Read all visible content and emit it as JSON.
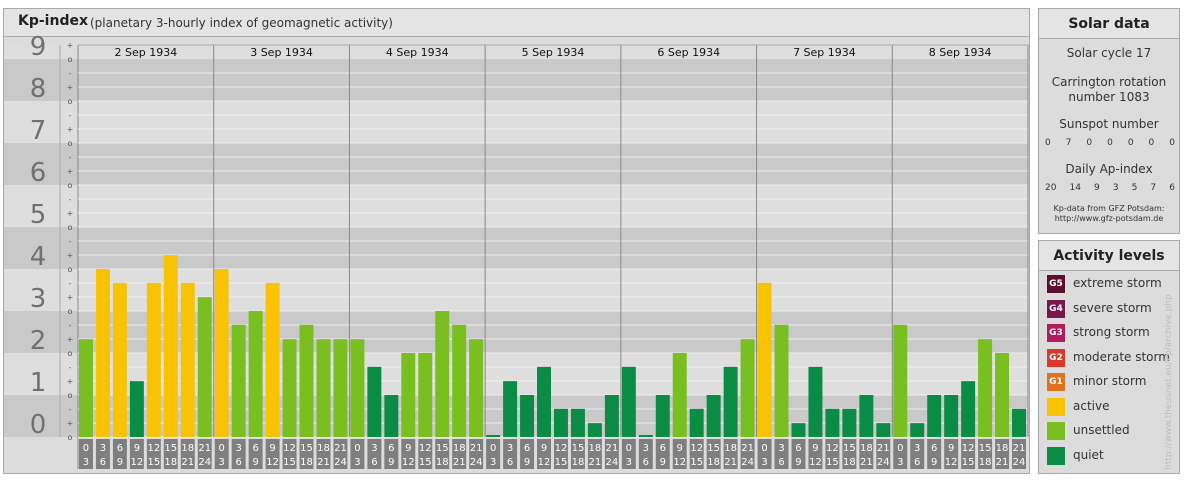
{
  "header": {
    "title": "Kp-index",
    "subtitle": "(planetary 3-hourly index of geomagnetic activity)"
  },
  "solar": {
    "heading": "Solar data",
    "cycle": "Solar cycle 17",
    "carrington_line1": "Carrington rotation",
    "carrington_line2": "number 1083",
    "sunspot_heading": "Sunspot number",
    "sunspot_values": [
      "0",
      "7",
      "0",
      "0",
      "0",
      "0",
      "0"
    ],
    "ap_heading": "Daily Ap-index",
    "ap_values": [
      "20",
      "14",
      "9",
      "3",
      "5",
      "7",
      "6"
    ],
    "source_line1": "Kp-data from GFZ Potsdam:",
    "source_line2": "http://www.gfz-potsdam.de"
  },
  "levels": {
    "heading": "Activity levels",
    "items": [
      {
        "badge": "G5",
        "label": "extreme storm",
        "color": "#5a0f2e"
      },
      {
        "badge": "G4",
        "label": "severe storm",
        "color": "#7a1649"
      },
      {
        "badge": "G3",
        "label": "strong storm",
        "color": "#b01c5c"
      },
      {
        "badge": "G2",
        "label": "moderate storm",
        "color": "#d8392b"
      },
      {
        "badge": "G1",
        "label": "minor storm",
        "color": "#e0741e"
      },
      {
        "badge": "",
        "label": "active",
        "color": "#f7c304"
      },
      {
        "badge": "",
        "label": "unsettled",
        "color": "#78bf1f"
      },
      {
        "badge": "",
        "label": "quiet",
        "color": "#0a8c45"
      }
    ]
  },
  "watermark": "http://www.theusnet.eu/kp/archive.php",
  "chart_data": {
    "type": "bar",
    "title": "Kp-index",
    "subtitle": "(planetary 3-hourly index of geomagnetic activity)",
    "ylim": [
      0,
      9
    ],
    "y_ticks": [
      "0",
      "1",
      "2",
      "3",
      "4",
      "5",
      "6",
      "7",
      "8",
      "9"
    ],
    "y_minor_marks": [
      "o",
      "+",
      "-"
    ],
    "days": [
      "2 Sep 1934",
      "3 Sep 1934",
      "4 Sep 1934",
      "5 Sep 1934",
      "6 Sep 1934",
      "7 Sep 1934",
      "8 Sep 1934"
    ],
    "slot_labels_top": [
      "0",
      "3",
      "6",
      "9",
      "12",
      "15",
      "18",
      "21"
    ],
    "slot_labels_bottom": [
      "3",
      "6",
      "9",
      "12",
      "15",
      "18",
      "21",
      "24"
    ],
    "colors": {
      "quiet": "#0a8c45",
      "unsettled": "#78bf1f",
      "active": "#f7c304"
    },
    "values": [
      [
        2.33,
        4.0,
        3.67,
        1.33,
        3.67,
        4.33,
        3.67,
        3.33
      ],
      [
        4.0,
        2.67,
        3.0,
        3.67,
        2.33,
        2.67,
        2.33,
        2.33
      ],
      [
        2.33,
        1.67,
        1.0,
        2.0,
        2.0,
        3.0,
        2.67,
        2.33
      ],
      [
        0.0,
        1.33,
        1.0,
        1.67,
        0.67,
        0.67,
        0.33,
        1.0
      ],
      [
        1.67,
        0.0,
        1.0,
        2.0,
        0.67,
        1.0,
        1.67,
        2.33
      ],
      [
        3.67,
        2.67,
        0.33,
        1.67,
        0.67,
        0.67,
        1.0,
        0.33
      ],
      [
        2.67,
        0.33,
        1.0,
        1.0,
        1.33,
        2.33,
        2.0,
        0.67
      ]
    ]
  }
}
